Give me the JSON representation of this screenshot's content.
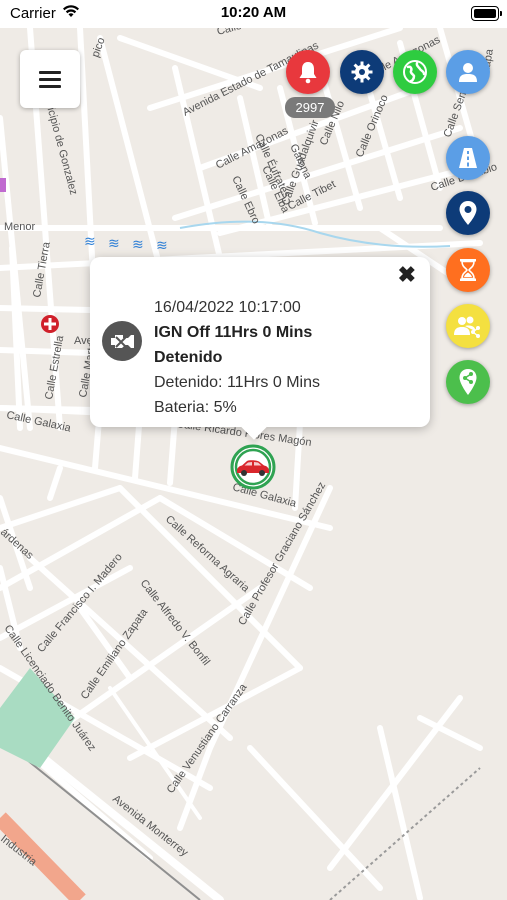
{
  "status_bar": {
    "carrier": "Carrier",
    "time": "10:20 AM"
  },
  "top_actions": {
    "alerts_count": "2997",
    "colors": {
      "alerts": "#e8383d",
      "settings": "#0d3b78",
      "globe": "#2ecc40",
      "profile": "#5b9ee6"
    }
  },
  "side_actions": {
    "icons": [
      "road-icon",
      "location-pin-icon",
      "hourglass-icon",
      "group-share-icon",
      "share-icon"
    ],
    "colors": [
      "#5b9ee6",
      "#0d3b78",
      "#ff6f1f",
      "#f4e040",
      "#4cbf4c"
    ]
  },
  "popup": {
    "datetime": "16/04/2022 10:17:00",
    "title_line1": "IGN Off 11Hrs 0 Mins",
    "title_line2": "Detenido",
    "detail_stopped": "Detenido: 11Hrs 0 Mins",
    "detail_battery": "Bateria: 5%",
    "close_symbol": "✖"
  },
  "map": {
    "streets": {
      "tamaulipas": "Avenida Estado de Tamaulipas",
      "amazonas": "Calle Amazonas",
      "amazonas_2": "Calle Amazonas",
      "eufrates": "Calle Éufrates",
      "elba": "Calle Elba",
      "ebro": "Calle Ebro",
      "garona": "Garona",
      "guadalquivir": "Calle Guadalquivir",
      "tibet": "Calle Tibet",
      "nilo": "Calle Nilo",
      "orinoco": "Calle Orinoco",
      "danubio": "Calle Danubio",
      "senegal": "Calle Seneg",
      "municipio_gonzalez": "Municipio de Gonzalez",
      "menor": "Menor",
      "tierra": "Calle Tierra",
      "estrella": "Calle Estrella",
      "marte": "Calle Marte",
      "galaxia_left": "Calle Galaxia",
      "galaxia_right": "Calle Galaxia",
      "flores_magon": "Calle Ricardo Flores Magón",
      "reforma_agraria": "Calle Reforma Agraria",
      "graciano_sanchez": "Calle Profesor Graciano Sánchez",
      "fl_madero": "Calle Francisco I. Madero",
      "alfredo_bonfil": "Calle Alfredo V. Bonfil",
      "emiliano_zapata": "Calle Emiliano Zapata",
      "benito_juarez": "Calle Licenciado Benito Juárez",
      "venustiano": "Calle Venustiano Carranza",
      "monterrey": "Avenida Monterrey",
      "industria": "Industria",
      "cardenas": "árdenas",
      "top_left": "pico",
      "calle_top": "Calle",
      "etapa": "Etapa",
      "ave": "Ave"
    }
  }
}
